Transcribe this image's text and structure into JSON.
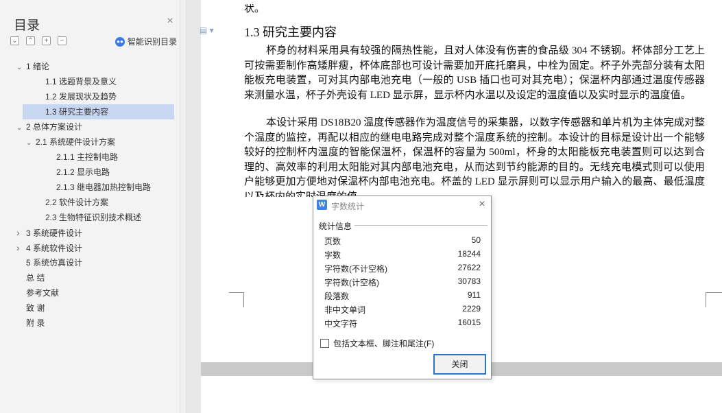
{
  "sidebar": {
    "title": "目录",
    "close_icon": "close-icon",
    "smart_toc_label": "智能识别目录",
    "tools": [
      "expand-all",
      "collapse-all",
      "add",
      "remove"
    ],
    "items": [
      {
        "arrow": "down",
        "label": "1  绪论"
      },
      {
        "arrow": "",
        "label": "1.1  选题背景及意义"
      },
      {
        "arrow": "",
        "label": "1.2  发展现状及趋势"
      },
      {
        "arrow": "",
        "label": "1.3  研究主要内容",
        "active": true
      },
      {
        "arrow": "down",
        "label": "2  总体方案设计"
      },
      {
        "arrow": "down",
        "label": "2.1  系统硬件设计方案"
      },
      {
        "arrow": "",
        "label": "2.1.1  主控制电路"
      },
      {
        "arrow": "",
        "label": "2.1.2  显示电路"
      },
      {
        "arrow": "",
        "label": "2.1.3  继电器加热控制电路"
      },
      {
        "arrow": "",
        "label": "2.2  软件设计方案"
      },
      {
        "arrow": "",
        "label": "2.3  生物特征识别技术概述"
      },
      {
        "arrow": "right",
        "label": "3  系统硬件设计"
      },
      {
        "arrow": "right",
        "label": "4  系统软件设计"
      },
      {
        "arrow": "",
        "label": "5  系统仿真设计"
      },
      {
        "arrow": "",
        "label": "总    结"
      },
      {
        "arrow": "",
        "label": "参考文献"
      },
      {
        "arrow": "",
        "label": "致    谢"
      },
      {
        "arrow": "",
        "label": "附    录"
      }
    ]
  },
  "document": {
    "top_fragment": "状。",
    "heading": "1.3  研究主要内容",
    "paragraph1": "杯身的材料采用具有较强的隔热性能，且对人体没有伤害的食品级 304 不锈钢。杯体部分工艺上可按需要制作高矮胖瘦，杯体底部也可设计需要加开底托磨具，中栓为固定。杯子外壳部分装有太阳能板充电装置，可对其内部电池充电（一般的 USB 插口也可对其充电）；保温杯内部通过温度传感器来测量水温，杯子外壳设有 LED 显示屏，显示杯内水温以及设定的温度值以及实时显示的温度值。",
    "paragraph2": "本设计采用 DS18B20 温度传感器作为温度信号的采集器，以数字传感器和单片机为主体完成对整个温度的监控，再配以相应的继电电路完成对整个温度系统的控制。本设计的目标是设计出一个能够较好的控制杯内温度的智能保温杯，保温杯的容量为 500ml，杯身的太阳能板充电装置则可以达到合理的、高效率的利用太阳能对其内部电池充电，从而达到节约能源的目的。无线充电模式则可以使用户能够更加方便地对保温杯内部电池充电。杯盖的 LED 显示屏则可以显示用户输入的最高、最低温度以及杯内的实时温度的值。"
  },
  "dialog": {
    "title": "字数统计",
    "app_icon": "W",
    "section_label": "统计信息",
    "stats": [
      {
        "label": "页数",
        "value": "50"
      },
      {
        "label": "字数",
        "value": "18244"
      },
      {
        "label": "字符数(不计空格)",
        "value": "27622"
      },
      {
        "label": "字符数(计空格)",
        "value": "30783"
      },
      {
        "label": "段落数",
        "value": "911"
      },
      {
        "label": "非中文单词",
        "value": "2229"
      },
      {
        "label": "中文字符",
        "value": "16015"
      }
    ],
    "checkbox_label": "包括文本框、脚注和尾注(F)",
    "checkbox_checked": false,
    "close_button": "关闭"
  }
}
